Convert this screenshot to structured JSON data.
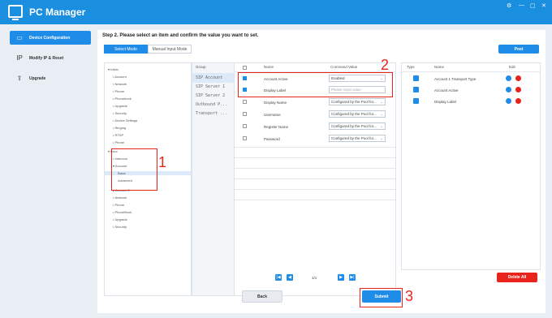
{
  "app": {
    "title": "PC Manager",
    "win_controls": [
      "⚙",
      "—",
      "▢",
      "✕"
    ]
  },
  "sidebar": {
    "items": [
      {
        "icon": "▭",
        "label": "Device Configuration",
        "active": true
      },
      {
        "icon": "IP",
        "label": "Modify IP & Reset",
        "active": false
      },
      {
        "icon": "⇪",
        "label": "Upgrade",
        "active": false
      }
    ]
  },
  "step_title": "Step 2. Please select an item and confirm the value you want to set.",
  "tabs": [
    "Select Mode",
    "Manual Input Mode"
  ],
  "post_label": "Post",
  "tree": [
    "▾ Initial",
    "• Account",
    "• Network",
    "• Phone",
    "• Phonebook",
    "• Upgrade",
    "• Security",
    "• Device Settings",
    "• Ringing",
    "• RTSP",
    "• Phone",
    "▾ Door",
    "• Intercom",
    "▾ Account",
    "Basic",
    "Advanced",
    "▸ Account 2",
    "• Network",
    "• Phone",
    "• PhoneBook",
    "• Upgrade",
    "• Security"
  ],
  "table": {
    "headers": {
      "group": "Group",
      "name": "Name",
      "value": "Command Value"
    },
    "groups": [
      "SIP Account",
      "SIP Server 1",
      "SIP Server 2",
      "Outbound P...",
      "Transport ..."
    ],
    "rows": [
      {
        "checked": true,
        "name": "Account Active",
        "value": "Enabled",
        "select": true
      },
      {
        "checked": true,
        "name": "Display Label",
        "value": "Please input value",
        "select": false
      },
      {
        "checked": false,
        "name": "Display Name",
        "value": "Configured by the Pool for...",
        "select": true
      },
      {
        "checked": false,
        "name": "Username",
        "value": "Configured by the Pool for...",
        "select": true
      },
      {
        "checked": false,
        "name": "Register Name",
        "value": "Configured by the Pool for...",
        "select": true
      },
      {
        "checked": false,
        "name": "Password",
        "value": "Configured by the Pool for...",
        "select": true
      }
    ]
  },
  "right_panel": {
    "headers": {
      "type": "Type",
      "name": "Name",
      "edit": "Edit"
    },
    "rows": [
      {
        "name": "Account 1 Transport Type"
      },
      {
        "name": "Account Active"
      },
      {
        "name": "Display Label"
      }
    ]
  },
  "pager": {
    "first": "|◀",
    "prev": "◀",
    "page": "1/1",
    "next": "▶",
    "last": "▶|"
  },
  "delete_all_label": "Delete All",
  "back_label": "Back",
  "submit_label": "Submit",
  "annotations": [
    "1",
    "2",
    "3"
  ],
  "colors": {
    "accent": "#1f8ce8",
    "danger": "#e8231c",
    "titlebar": "#1a8fe0"
  }
}
